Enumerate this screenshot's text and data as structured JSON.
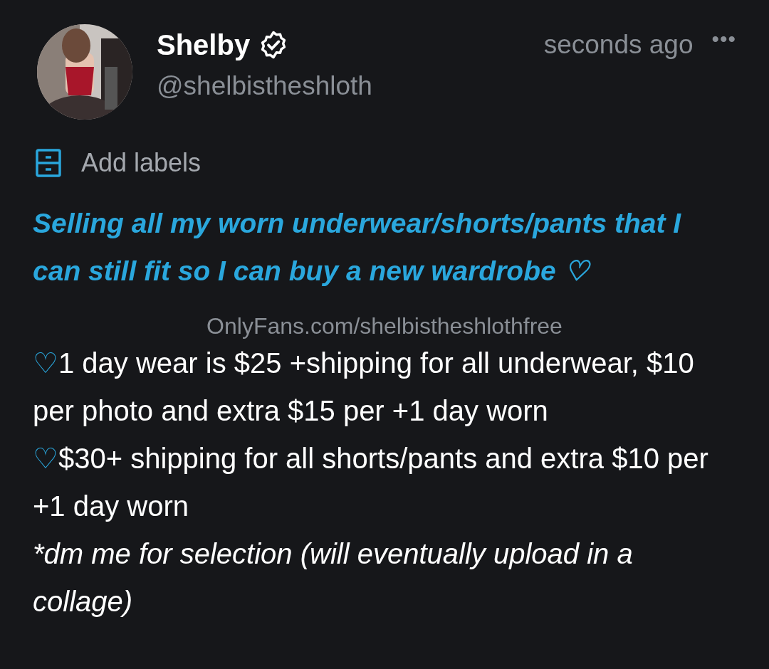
{
  "post": {
    "author": {
      "name": "Shelby",
      "verified": true,
      "handle": "@shelbistheshloth"
    },
    "time": "seconds ago",
    "menu": "•••",
    "labels_action": "Add labels",
    "headline": "Selling all my worn underwear/shorts/pants that I can still fit so I can buy a new wardrobe ♡",
    "link": "OnlyFans.com/shelbistheshlothfree",
    "paragraphs": [
      {
        "kind": "bullet",
        "bullet": "♡",
        "text": "1 day wear is $25 +shipping for all underwear, $10 per photo and extra $15 per +1 day worn"
      },
      {
        "kind": "bullet",
        "bullet": "♡",
        "text": "$30+ shipping for all shorts/pants and extra $10 per +1 day worn"
      },
      {
        "kind": "italic",
        "text": "*dm me for selection (will eventually upload in a collage)"
      }
    ]
  }
}
